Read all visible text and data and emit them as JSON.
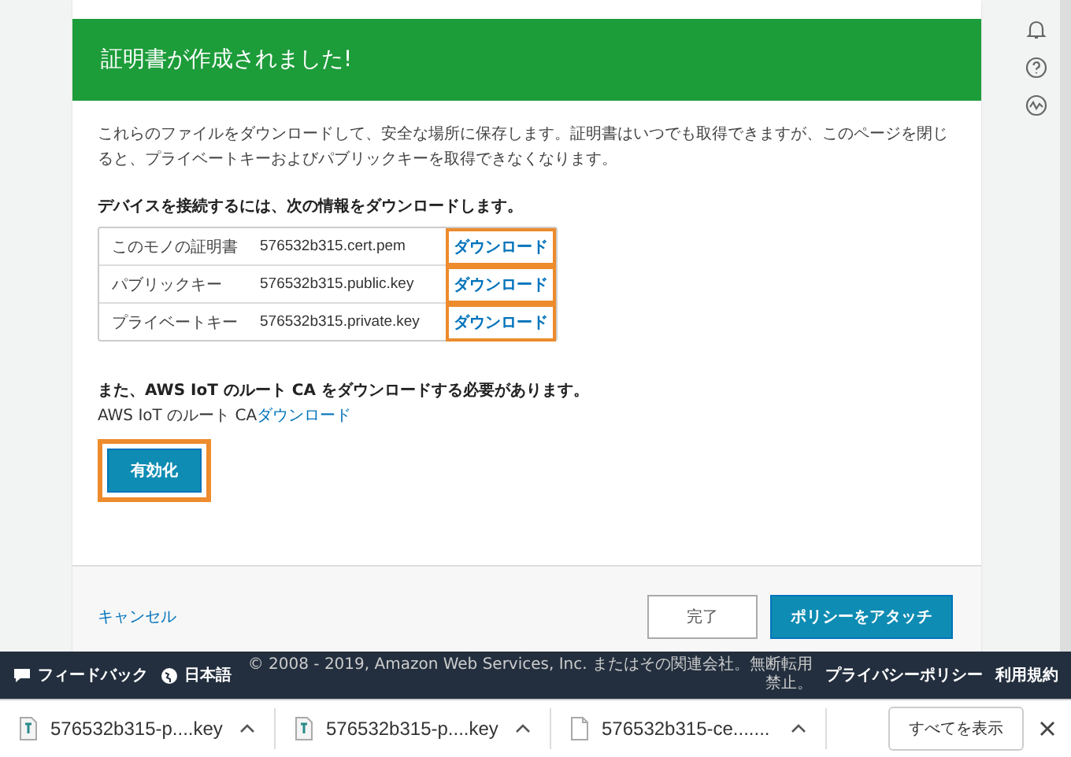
{
  "header": {
    "title": "証明書が作成されました!"
  },
  "intro": "これらのファイルをダウンロードして、安全な場所に保存します。証明書はいつでも取得できますが、このページを閉じると、プライベートキーおよびパブリックキーを取得できなくなります。",
  "files_heading": "デバイスを接続するには、次の情報をダウンロードします。",
  "files": [
    {
      "label": "このモノの証明書",
      "file": "576532b315.cert.pem",
      "action": "ダウンロード",
      "highlighted": true
    },
    {
      "label": "パブリックキー",
      "file": "576532b315.public.key",
      "action": "ダウンロード",
      "highlighted": true
    },
    {
      "label": "プライベートキー",
      "file": "576532b315.private.key",
      "action": "ダウンロード",
      "highlighted": true
    }
  ],
  "root_ca": {
    "note": "また、AWS IoT のルート CA をダウンロードする必要があります。",
    "line": "AWS IoT のルート CA",
    "link": "ダウンロード"
  },
  "activate_button": {
    "label": "有効化",
    "highlighted": true
  },
  "footer": {
    "cancel": "キャンセル",
    "buttons": [
      {
        "label": "完了",
        "kind": "secondary"
      },
      {
        "label": "ポリシーをアタッチ",
        "kind": "primary"
      }
    ]
  },
  "console_footer": {
    "feedback": "フィードバック",
    "language": "日本語",
    "copyright": "© 2008 - 2019, Amazon Web Services, Inc. またはその関連会社。無断転用禁止。",
    "links": [
      "プライバシーポリシー",
      "利用規約"
    ]
  },
  "downloads": {
    "items": [
      {
        "name": "576532b315-p....key",
        "kind": "key"
      },
      {
        "name": "576532b315-p....key",
        "kind": "key"
      },
      {
        "name": "576532b315-ce.......",
        "kind": "file"
      }
    ],
    "show_all": "すべてを表示"
  }
}
